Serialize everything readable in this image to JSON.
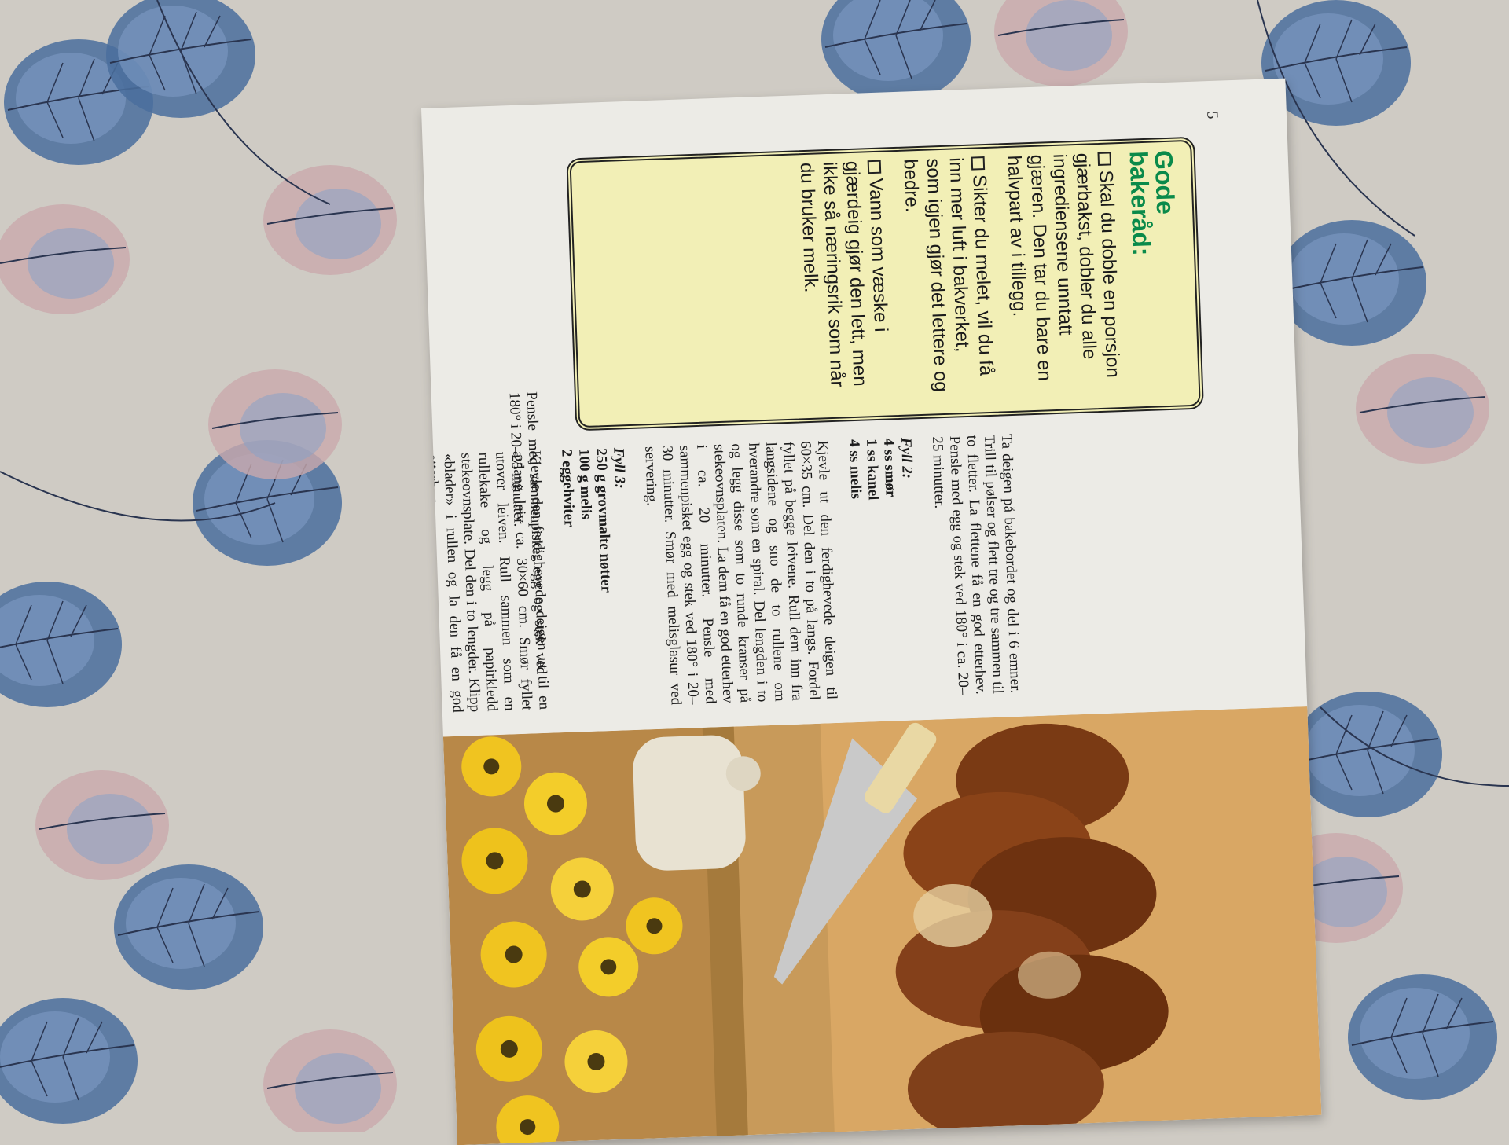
{
  "page": {
    "number": "5",
    "column1": {
      "intro": "Ta deigen på bakebordet og del i 6 emner. Trill til pølser og flett tre og tre sammen til to fletter. La flettene få en god etterhev. Pensle med egg og stek ved 180° i ca. 20–25 minutter.",
      "fill2_title": "Fyll 2:",
      "fill2_items": [
        "4 ss smør",
        "1 ss kanel",
        "4 ss melis"
      ],
      "fill2_text": "Kjevle ut den ferdighevede deigen til 60×35 cm. Del den i to på langs. Fordel fyllet på begge leivene. Rull dem inn fra langsidene og sno de to rullene om hverandre som en spiral. Del lengden i to og legg disse som to runde kranser på stekeovnsplaten. La dem få en god etterhev i ca. 20 minutter. Pensle med sammenpisket egg og stek ved 180° i 20–30 minutter. Smør med melisglasur ved servering.",
      "fill3_title": "Fyll 3:",
      "fill3_items": [
        "250 g grovmalte nøtter",
        "100 g melis",
        "2 eggehviter"
      ],
      "fill3_text": "Kjevle den ferdighevede deigen ut til en avlang leiv ca. 30×60 cm. Smør fyllet utover leiven. Rull sammen som en rullekake og legg på papirkledd stekeovnsplate. Del den i to lengder. Klipp «blader» i rullen og la den få en god etterhev."
    },
    "column2": {
      "text": "Pensle med sammenpisket egg og stek ved 180° i 20–25 minutter."
    },
    "tips": {
      "title_line1": "Gode",
      "title_line2": "bakeråd:",
      "items": [
        "Skal du doble en porsjon gjærbakst, dobler du alle ingrediensene unntatt gjæren. Den tar du bare en halvpart av i tillegg.",
        "Sikter du melet, vil du få inn mer luft i bakverket, som igjen gjør det lettere og bedre.",
        "Vann som væske i gjærdeig gjør den lett, men ikke så næringsrik som når du bruker melk."
      ]
    }
  },
  "colors": {
    "tip_title": "#0a8a4a",
    "tip_box": "#f2efb6",
    "paper": "#ecebe6",
    "cloth": "#cfcbc4",
    "leaf_blue": "#4a6e9e",
    "leaf_pink": "#c9a9ac"
  }
}
